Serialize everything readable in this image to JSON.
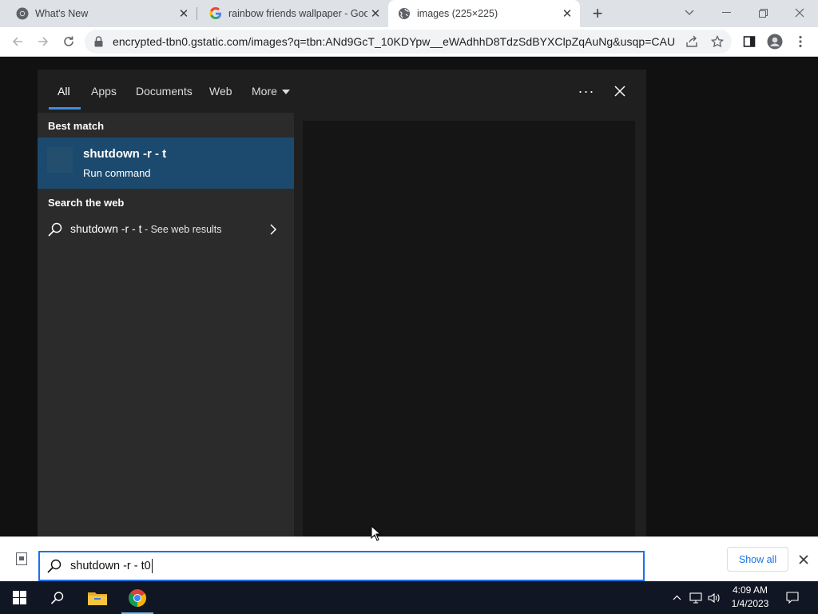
{
  "browser": {
    "tabs": [
      {
        "title": "What's New",
        "favicon": "chrome-icon",
        "active": false
      },
      {
        "title": "rainbow friends wallpaper - Goog",
        "favicon": "google-icon",
        "active": false
      },
      {
        "title": "images (225×225)",
        "favicon": "globe-icon",
        "active": true
      }
    ],
    "new_tab_label": "+",
    "url": "encrypted-tbn0.gstatic.com/images?q=tbn:ANd9GcT_10KDYpw__eWAdhhD8TdzSdBYXClpZqAuNg&usqp=CAU"
  },
  "search_flyout": {
    "tabs": [
      "All",
      "Apps",
      "Documents",
      "Web",
      "More"
    ],
    "active_tab": "All",
    "more_options_label": "···",
    "best_match_heading": "Best match",
    "best_match": {
      "title": "shutdown -r - t",
      "subtitle": "Run command"
    },
    "search_web_heading": "Search the web",
    "web_result": {
      "query": "shutdown -r - t",
      "suffix": " - See web results"
    },
    "accent_color": "#1c4a6e"
  },
  "search_box": {
    "value": "shutdown -r - t0"
  },
  "download_shelf": {
    "show_all_label": "Show all"
  },
  "taskbar": {
    "items": [
      "windows-start-icon",
      "search-icon",
      "file-explorer-icon",
      "chrome-icon"
    ],
    "time": "4:09 AM",
    "date": "1/4/2023"
  }
}
